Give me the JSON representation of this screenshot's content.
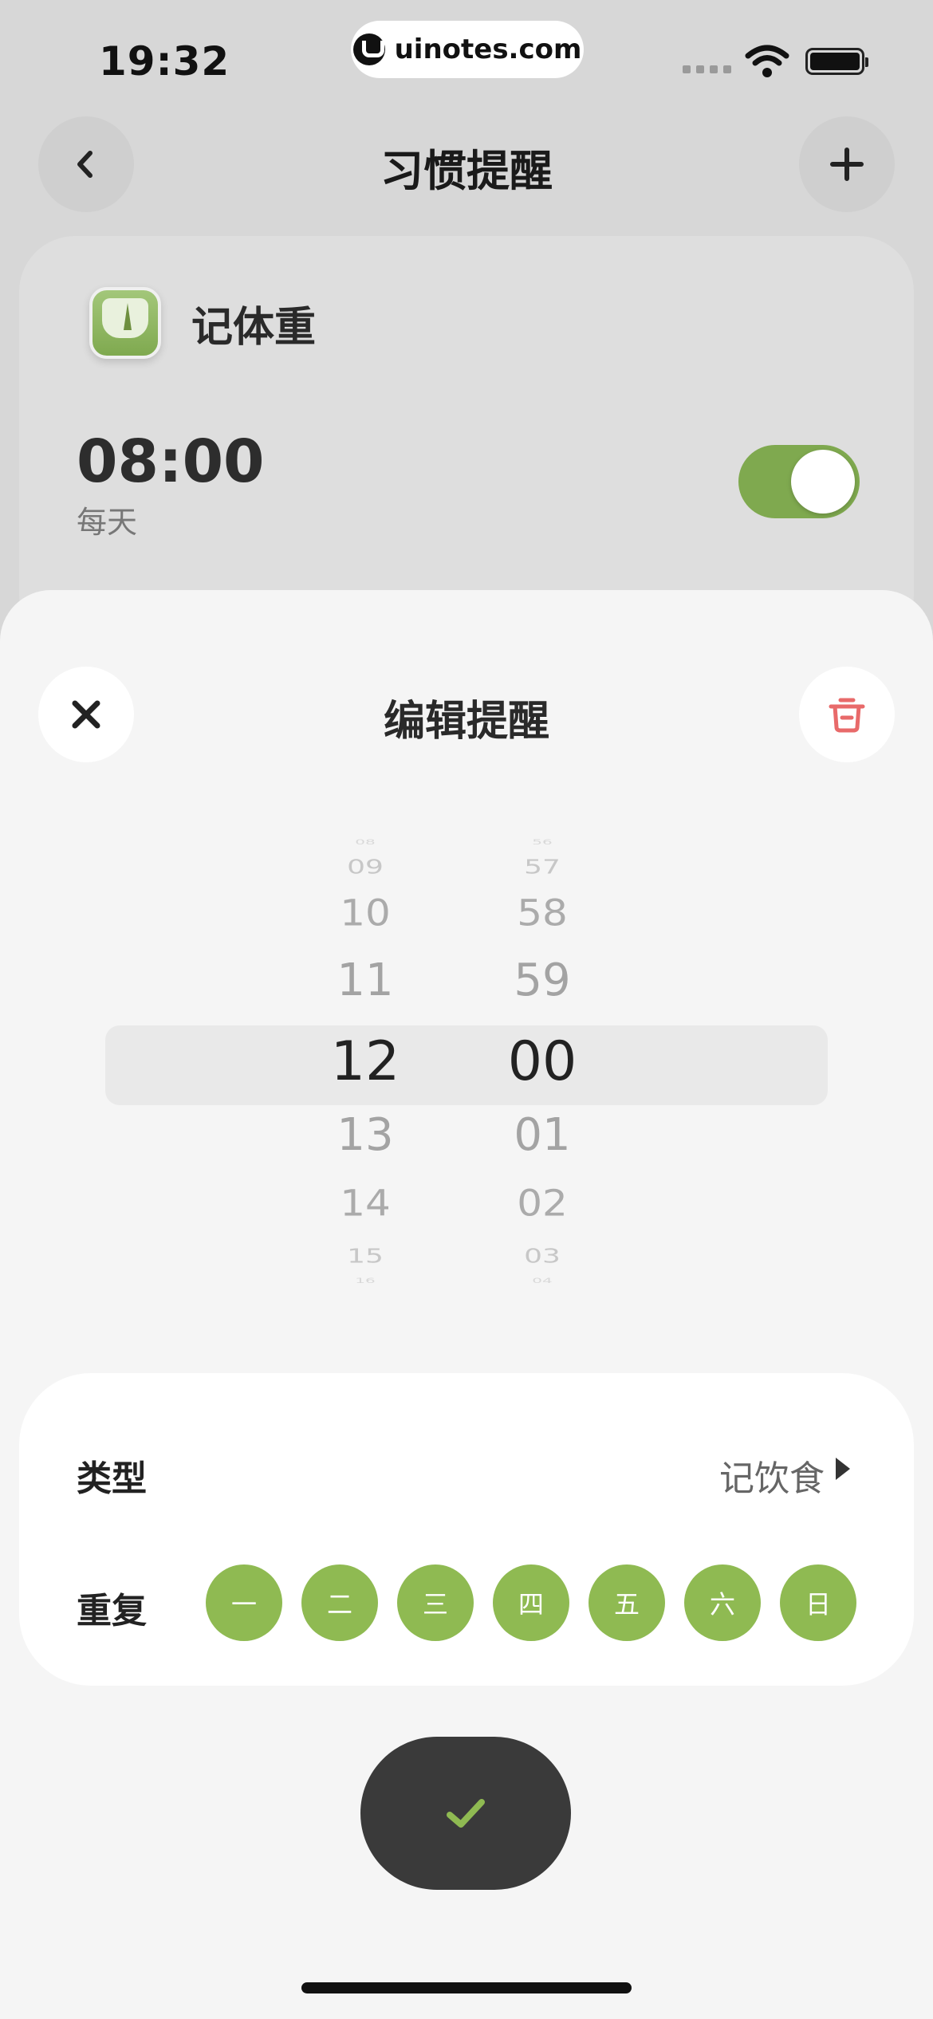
{
  "status_bar": {
    "time": "19:32",
    "url": "uinotes.com"
  },
  "header": {
    "title": "习惯提醒",
    "back_icon": "chevron-left-icon",
    "add_icon": "plus-icon"
  },
  "habit_card": {
    "name": "记体重",
    "time": "08:00",
    "repeat": "每天",
    "enabled": true,
    "accent": "#7fa94f"
  },
  "sheet": {
    "title": "编辑提醒",
    "close_icon": "close-icon",
    "delete_icon": "trash-icon",
    "delete_color": "#e86a6a",
    "picker": {
      "hours": [
        "08",
        "09",
        "10",
        "11",
        "12",
        "13",
        "14",
        "15",
        "16"
      ],
      "minutes": [
        "56",
        "57",
        "58",
        "59",
        "00",
        "01",
        "02",
        "03",
        "04"
      ],
      "selected_hour": "12",
      "selected_minute": "00"
    },
    "type_label": "类型",
    "type_value": "记饮食",
    "repeat_label": "重复",
    "days": [
      "一",
      "二",
      "三",
      "四",
      "五",
      "六",
      "日"
    ],
    "day_color": "#8fba52",
    "confirm_icon": "check-icon"
  }
}
